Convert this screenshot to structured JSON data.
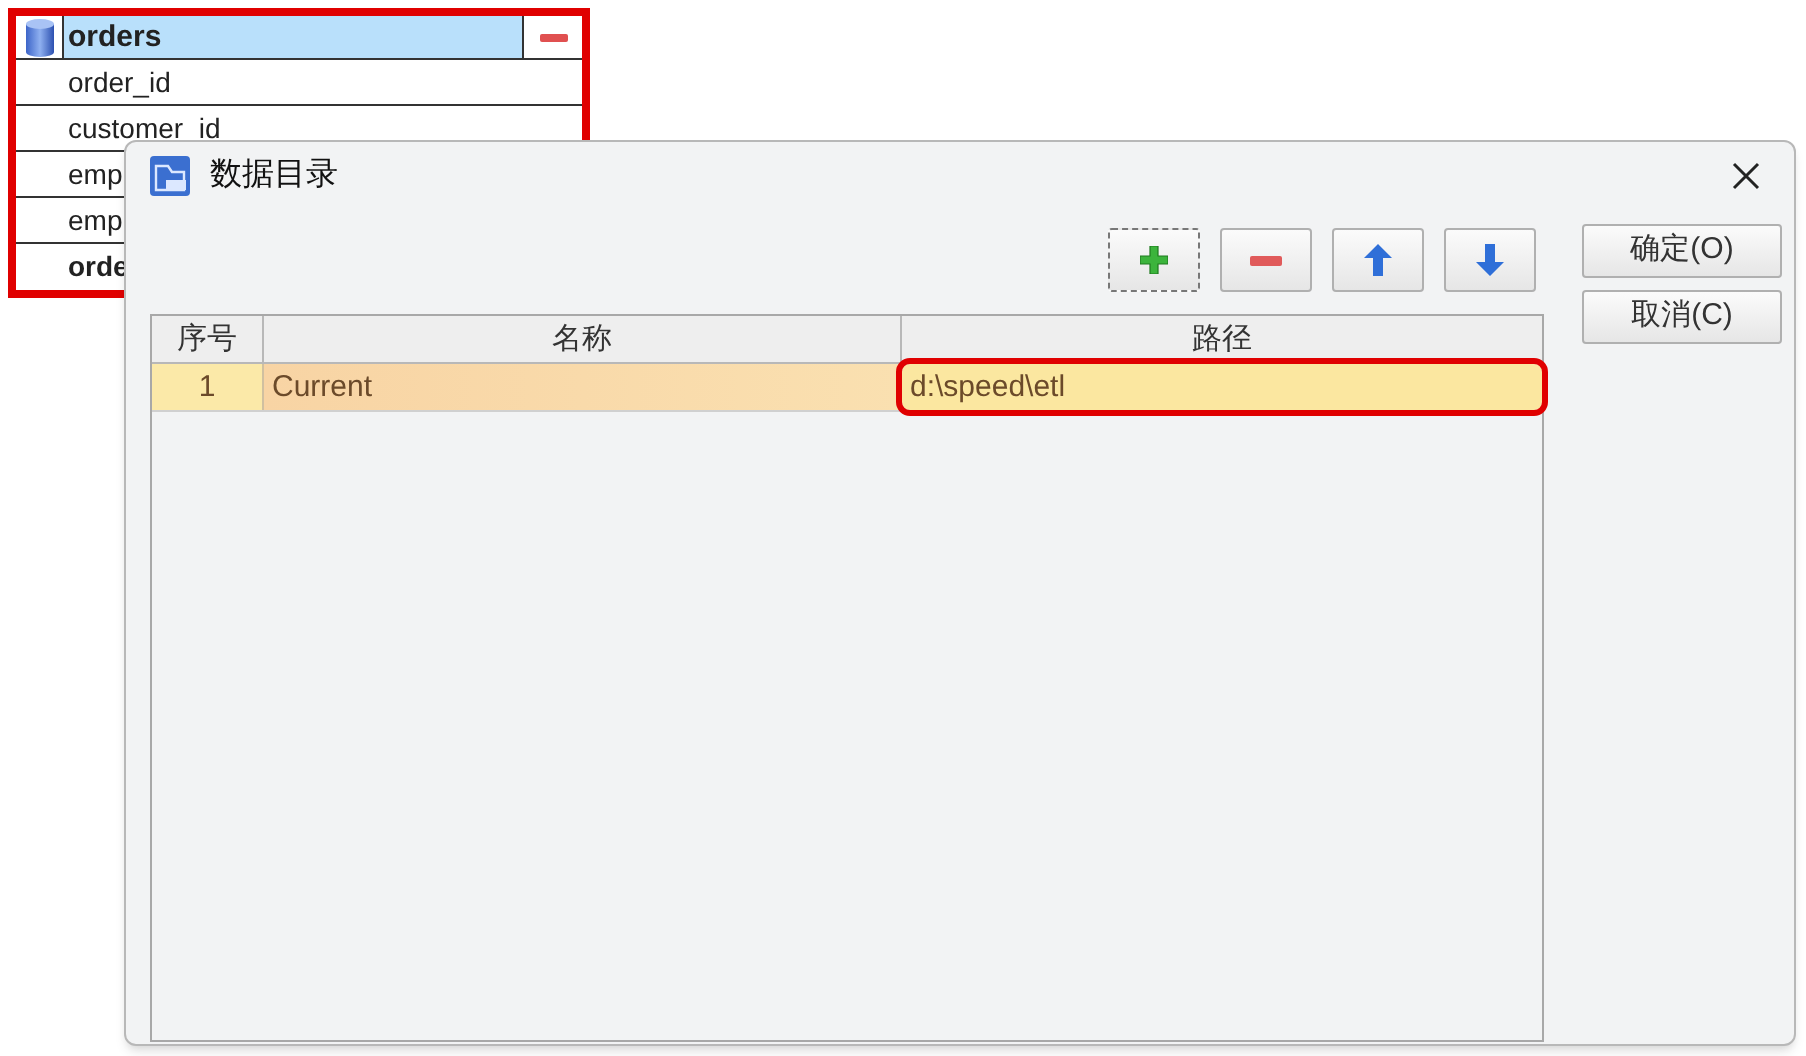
{
  "background_table": {
    "title": "orders",
    "fields": [
      {
        "text": "order_id",
        "bold": false
      },
      {
        "text": "customer_id",
        "bold": false
      },
      {
        "text": "emp",
        "bold": false
      },
      {
        "text": "emp",
        "bold": false
      },
      {
        "text": "orde",
        "bold": true
      }
    ]
  },
  "dialog": {
    "title": "数据目录",
    "toolbar": [
      {
        "kind": "add",
        "focused": true
      },
      {
        "kind": "remove",
        "focused": false
      },
      {
        "kind": "up",
        "focused": false
      },
      {
        "kind": "down",
        "focused": false
      }
    ],
    "buttons": [
      "确定(O)",
      "取消(C)"
    ],
    "table": {
      "columns": [
        "序号",
        "名称",
        "路径"
      ],
      "rows": [
        {
          "cells": [
            {
              "text": "1",
              "highlighted": false
            },
            {
              "text": "Current",
              "highlighted": false
            },
            {
              "text": "d:\\speed\\etl",
              "highlighted": true
            }
          ],
          "selected": true
        }
      ]
    }
  }
}
